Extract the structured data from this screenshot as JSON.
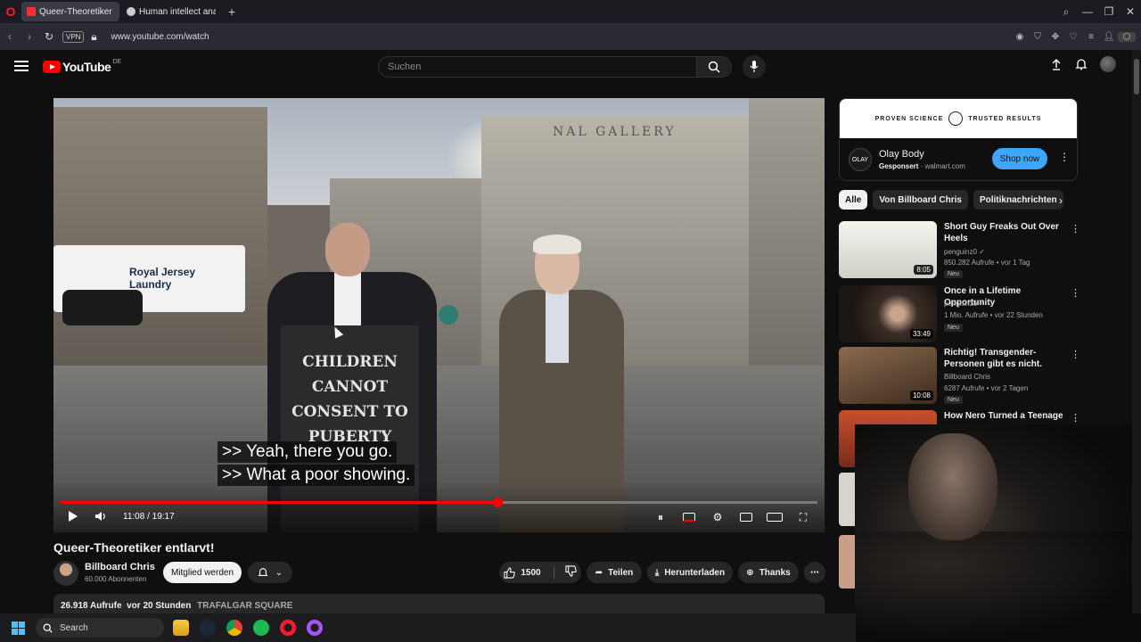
{
  "browser": {
    "tabs": [
      {
        "title": "Queer-Theoretiker entlarvt",
        "active": true,
        "favicon_color": "#ff2d2d"
      },
      {
        "title": "Human intellect analysis",
        "active": false,
        "favicon_color": "#cccccc"
      }
    ],
    "vpn_label": "VPN",
    "url": "www.youtube.com/watch"
  },
  "header": {
    "logo_text": "YouTube",
    "country_code": "DE",
    "search_placeholder": "Suchen"
  },
  "player": {
    "sign_lines": [
      "CHILDREN",
      "CANNOT",
      "CONSENT TO",
      "PUBERTY"
    ],
    "building_text": "NAL GALLERY",
    "truck_text": "Royal Jersey\nLaundry",
    "captions": [
      ">> Yeah, there you go.",
      ">> What a poor showing."
    ],
    "time_current": "11:08",
    "time_total": "19:17",
    "progress": 0.577
  },
  "video": {
    "title": "Queer-Theoretiker entlarvt!",
    "channel": "Billboard Chris",
    "subscribers": "60.000 Abonnenten",
    "join_label": "Mitglied werden",
    "likes": "1500",
    "share_label": "Teilen",
    "download_label": "Herunterladen",
    "thanks_label": "Thanks",
    "views": "26.918 Aufrufe",
    "age": "vor 20 Stunden",
    "location_tag": "TRAFALGAR SQUARE"
  },
  "ad": {
    "banner_left": "PROVEN SCIENCE",
    "banner_right": "TRUSTED RESULTS",
    "logo": "OLAY",
    "name": "Olay Body",
    "sponsored": "Gesponsert",
    "domain": "walmart.com",
    "cta": "Shop now"
  },
  "chips": [
    "Alle",
    "Von Billboard Chris",
    "Politiknachrichten"
  ],
  "recommendations": [
    {
      "title": "Short Guy Freaks Out Over Heels",
      "channel": "penguinz0",
      "meta": "850.282 Aufrufe • vor 1 Tag",
      "duration": "8:05",
      "badge": "Neu",
      "thumb": "#e8e8e0"
    },
    {
      "title": "Once in a Lifetime Opportunity",
      "channel": "penguinz0",
      "meta": "1 Mio. Aufrufe • vor 22 Stunden",
      "duration": "33:49",
      "badge": "Neu",
      "thumb": "#3a2e26"
    },
    {
      "title": "Richtig! Transgender-Personen gibt es nicht.",
      "channel": "Billboard Chris",
      "meta": "6287 Aufrufe • vor 2 Tagen",
      "duration": "10:08",
      "badge": "Neu",
      "thumb": "#6a4a2e"
    },
    {
      "title": "How Nero Turned a Teenage",
      "channel": "",
      "meta": "",
      "duration": "",
      "badge": "",
      "thumb": "#a8442a"
    }
  ],
  "taskbar": {
    "search_label": "Search"
  }
}
